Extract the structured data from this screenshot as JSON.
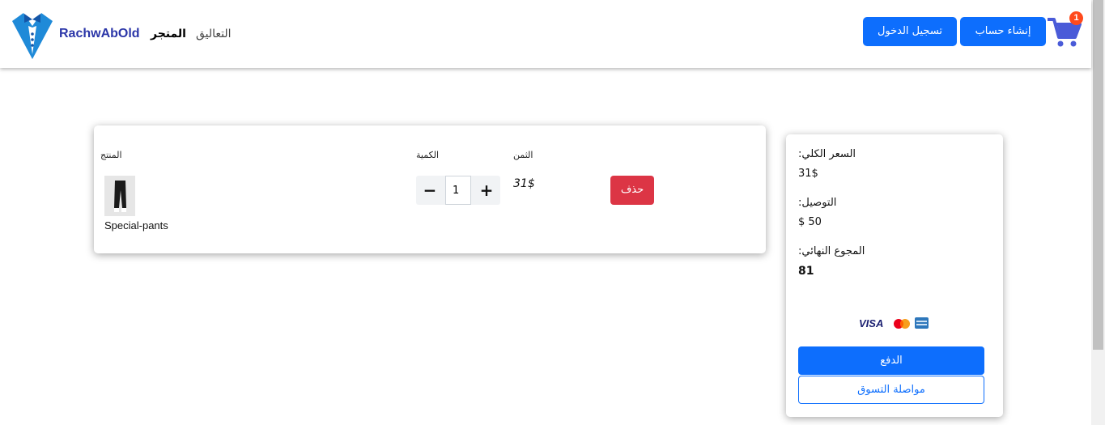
{
  "navbar": {
    "cart_badge": "1",
    "register_label": "إنشاء حساب",
    "login_label": "تسجيل الدخول",
    "nav_comments": "التعاليق",
    "nav_store": "المتجر",
    "brand": "RachwAbOld",
    "accent_color": "#0d6efd"
  },
  "cart_table": {
    "headers": {
      "product": "المنتج",
      "quantity": "الكمية",
      "price": "الثمن"
    },
    "rows": [
      {
        "name": "Special-pants",
        "quantity": "1",
        "price": "31$",
        "delete_label": "حذف"
      }
    ]
  },
  "summary": {
    "subtotal_label": ":السعر الكلي",
    "subtotal_value": "31$",
    "shipping_label": ":التوصيل",
    "shipping_value": "$ 50",
    "total_label": ":المجوع النهائي",
    "total_value": "81",
    "payment_logos": [
      "VISA",
      "mastercard-icon",
      "amex-icon"
    ],
    "pay_label": "الدفع",
    "continue_label": "مواصلة التسوق"
  }
}
